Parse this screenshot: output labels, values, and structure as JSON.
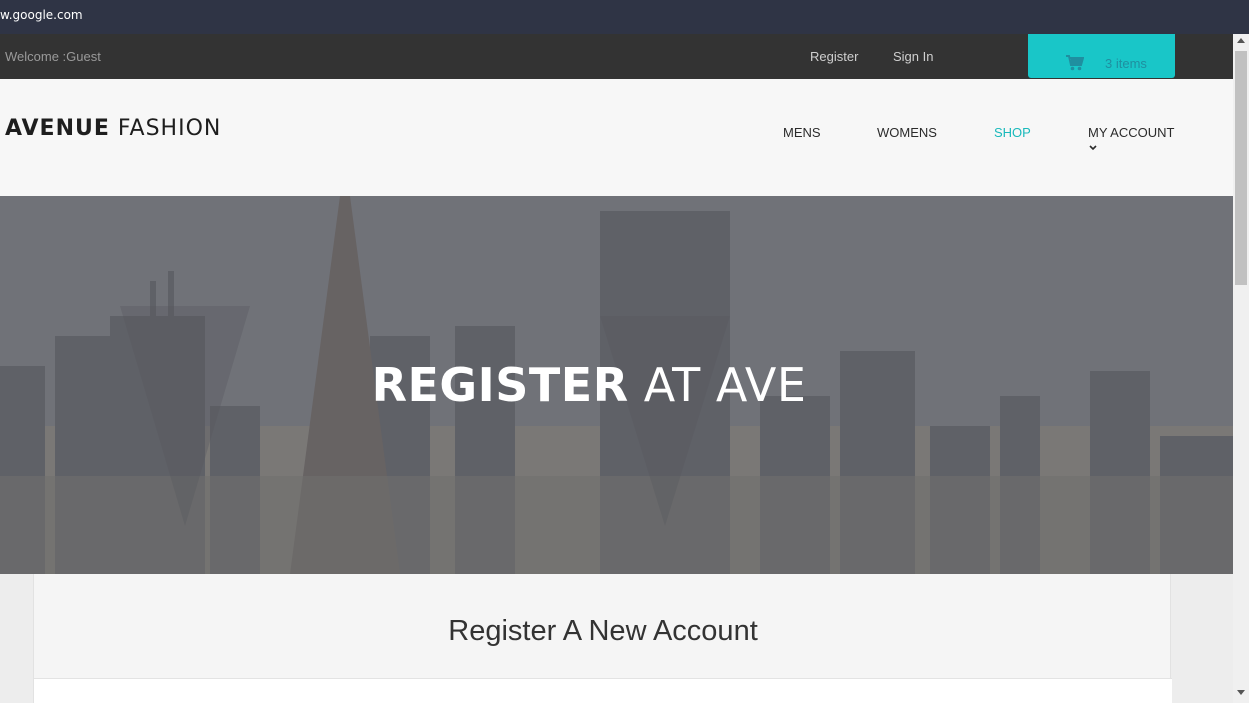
{
  "browser": {
    "url": "w.google.com"
  },
  "topbar": {
    "welcome": "Welcome :Guest",
    "register_label": "Register",
    "signin_label": "Sign In",
    "cart_count_label": "3 items",
    "cart_icon": "shopping-cart-icon"
  },
  "navbar": {
    "logo_bold": "AVENUE",
    "logo_light": " FASHION",
    "items": [
      {
        "label": "MENS"
      },
      {
        "label": "WOMENS"
      },
      {
        "label": "SHOP"
      },
      {
        "label": "MY ACCOUNT"
      }
    ],
    "active_item": "SHOP",
    "dropdown_icon": "chevron-down-icon"
  },
  "hero": {
    "title_bold": "REGISTER",
    "title_light": " AT AVE"
  },
  "panel": {
    "title": "Register A New Account"
  },
  "colors": {
    "accent": "#19c6c8",
    "topbar_bg": "#333333",
    "navbar_bg": "#f7f7f7",
    "browser_bar": "#2f3445"
  }
}
